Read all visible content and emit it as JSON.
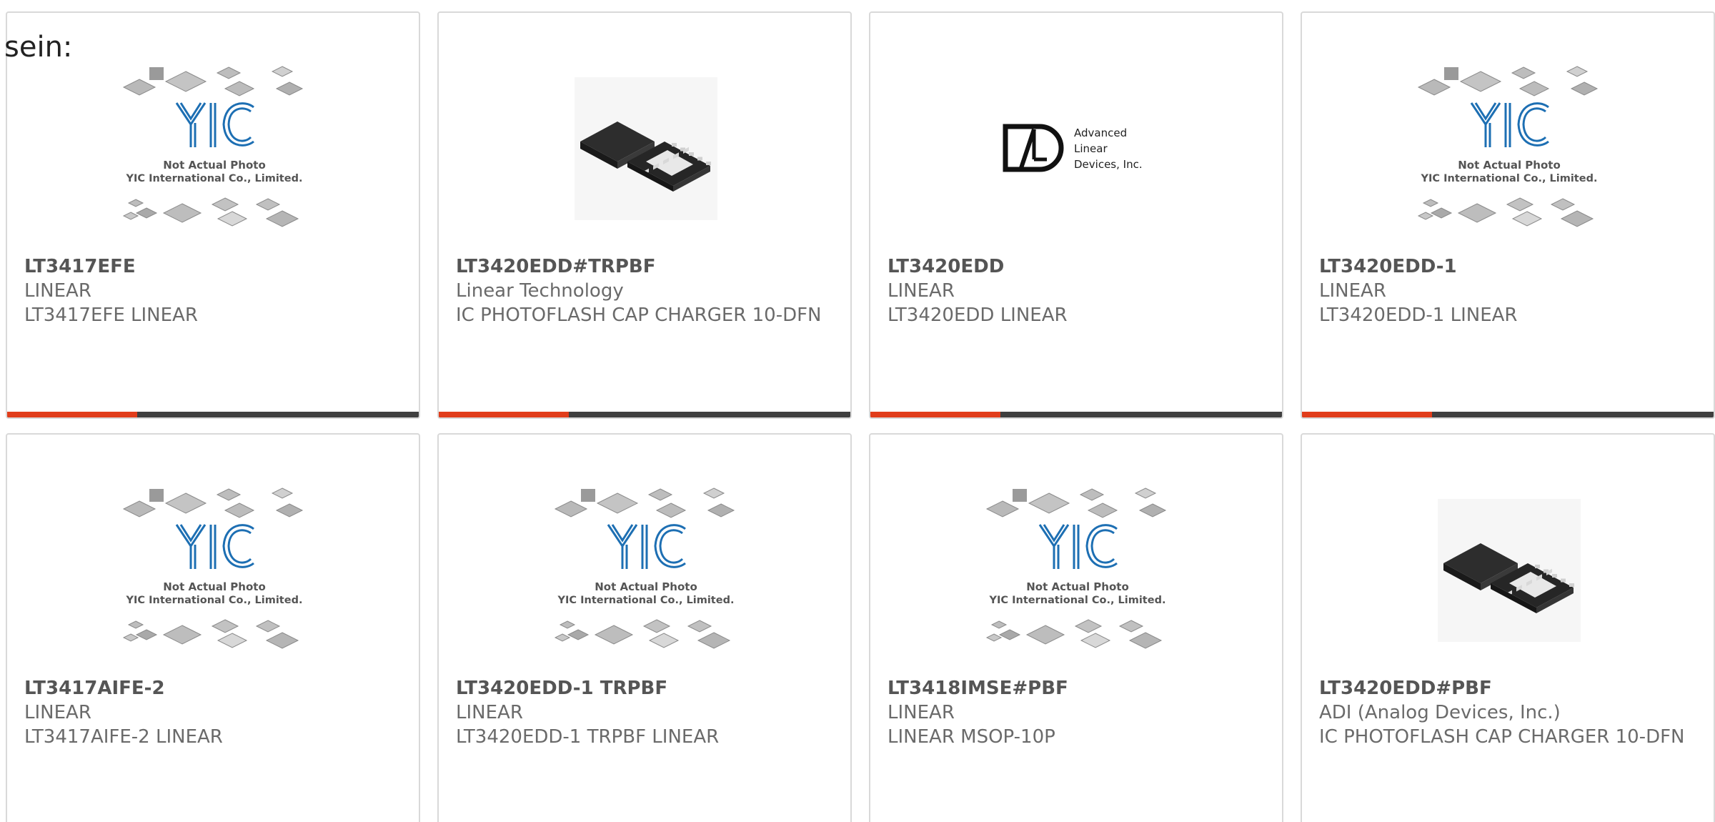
{
  "page": {
    "cut_text": "sein:"
  },
  "colors": {
    "accent": "#e13d1b",
    "bar": "#3f3f3f",
    "border": "#d9d9d9",
    "yic_blue": "#1d6fb3"
  },
  "placeholder": {
    "line1": "Not Actual Photo",
    "line2": "YIC International Co., Limited."
  },
  "ald_logo": {
    "line1": "Advanced",
    "line2": "Linear",
    "line3": "Devices, Inc."
  },
  "products": [
    {
      "part": "LT3417EFE",
      "brand": "LINEAR",
      "desc": "LT3417EFE LINEAR",
      "image": "yic-placeholder"
    },
    {
      "part": "LT3420EDD#TRPBF",
      "brand": "Linear Technology",
      "desc": "IC PHOTOFLASH CAP CHARGER 10-DFN",
      "image": "dfn-chip-photo"
    },
    {
      "part": "LT3420EDD",
      "brand": "LINEAR",
      "desc": "LT3420EDD LINEAR",
      "image": "ald-logo"
    },
    {
      "part": "LT3420EDD-1",
      "brand": "LINEAR",
      "desc": "LT3420EDD-1 LINEAR",
      "image": "yic-placeholder"
    },
    {
      "part": "LT3417AIFE-2",
      "brand": "LINEAR",
      "desc": "LT3417AIFE-2 LINEAR",
      "image": "yic-placeholder"
    },
    {
      "part": "LT3420EDD-1 TRPBF",
      "brand": "LINEAR",
      "desc": "LT3420EDD-1 TRPBF LINEAR",
      "image": "yic-placeholder"
    },
    {
      "part": "LT3418IMSE#PBF",
      "brand": "LINEAR",
      "desc": "LINEAR MSOP-10P",
      "image": "yic-placeholder"
    },
    {
      "part": "LT3420EDD#PBF",
      "brand": "ADI (Analog Devices, Inc.)",
      "desc": "IC PHOTOFLASH CAP CHARGER 10-DFN",
      "image": "dfn-chip-photo"
    }
  ]
}
